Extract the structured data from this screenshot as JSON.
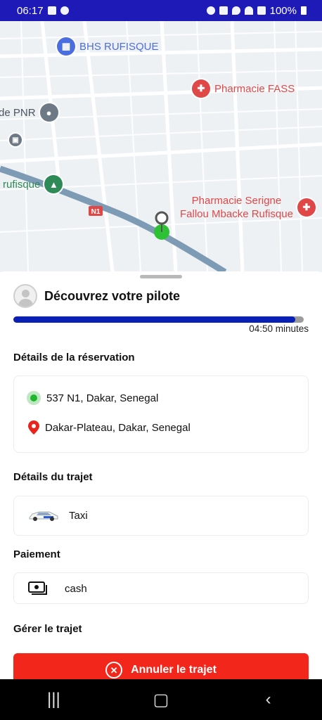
{
  "status_bar": {
    "time": "06:17",
    "battery": "100%"
  },
  "map": {
    "pois": [
      {
        "label": "BHS RUFISQUE",
        "icon": "bank-icon",
        "color": "#4a6ee0"
      },
      {
        "label": "Pharmacie FASS",
        "icon": "pharmacy-icon",
        "color": "#e04848"
      },
      {
        "label": "de PNR",
        "icon": "place-icon",
        "color": "#6d7a86"
      },
      {
        "label": "rufisque",
        "icon": "park-icon",
        "color": "#2e8b57"
      },
      {
        "label": "Pharmacie Serigne\nFallou Mbacke Rufisque",
        "icon": "pharmacy-icon",
        "color": "#e04848"
      }
    ],
    "road_label": "N1"
  },
  "sheet": {
    "title": "Découvrez votre pilote",
    "progress": 0.97,
    "timer": "04:50 minutes",
    "reservation": {
      "label": "Détails de la réservation",
      "pickup": "537 N1, Dakar, Senegal",
      "dropoff": "Dakar-Plateau, Dakar, Senegal"
    },
    "trip": {
      "label": "Détails du trajet",
      "vehicle": "Taxi"
    },
    "payment": {
      "label": "Paiement",
      "method": "cash"
    },
    "manage": {
      "label": "Gérer le trajet",
      "cancel": "Annuler le trajet"
    }
  },
  "colors": {
    "primary": "#0a1fb3",
    "danger": "#f2261b",
    "pickup": "#1fb82c",
    "dropoff": "#e8241c"
  }
}
